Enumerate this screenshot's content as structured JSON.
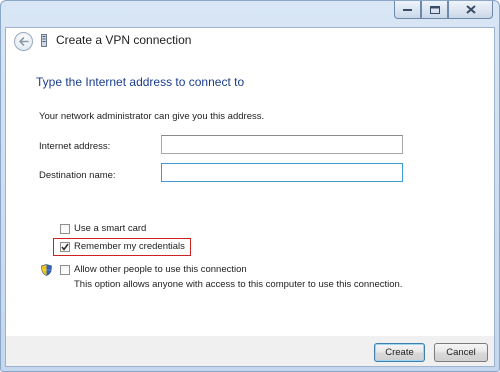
{
  "window": {
    "title": "Create a VPN connection",
    "heading": "Type the Internet address to connect to",
    "hint": "Your network administrator can give you this address."
  },
  "caption_buttons": {
    "minimize": "minimize-icon",
    "maximize": "maximize-icon",
    "close": "close-icon"
  },
  "fields": {
    "internet_address": {
      "label": "Internet address:",
      "value": ""
    },
    "destination_name": {
      "label": "Destination name:",
      "value": ""
    }
  },
  "options": {
    "smart_card": {
      "label": "Use a smart card",
      "checked": false
    },
    "remember_credentials": {
      "label": "Remember my credentials",
      "checked": true
    },
    "allow_others": {
      "label": "Allow other people to use this connection",
      "description": "This option allows anyone with access to this computer to use this connection.",
      "checked": false
    }
  },
  "buttons": {
    "create": "Create",
    "cancel": "Cancel"
  },
  "colors": {
    "heading": "#1a3e8c",
    "highlight_box": "#cc2222",
    "focus_border": "#3e9bd4"
  }
}
